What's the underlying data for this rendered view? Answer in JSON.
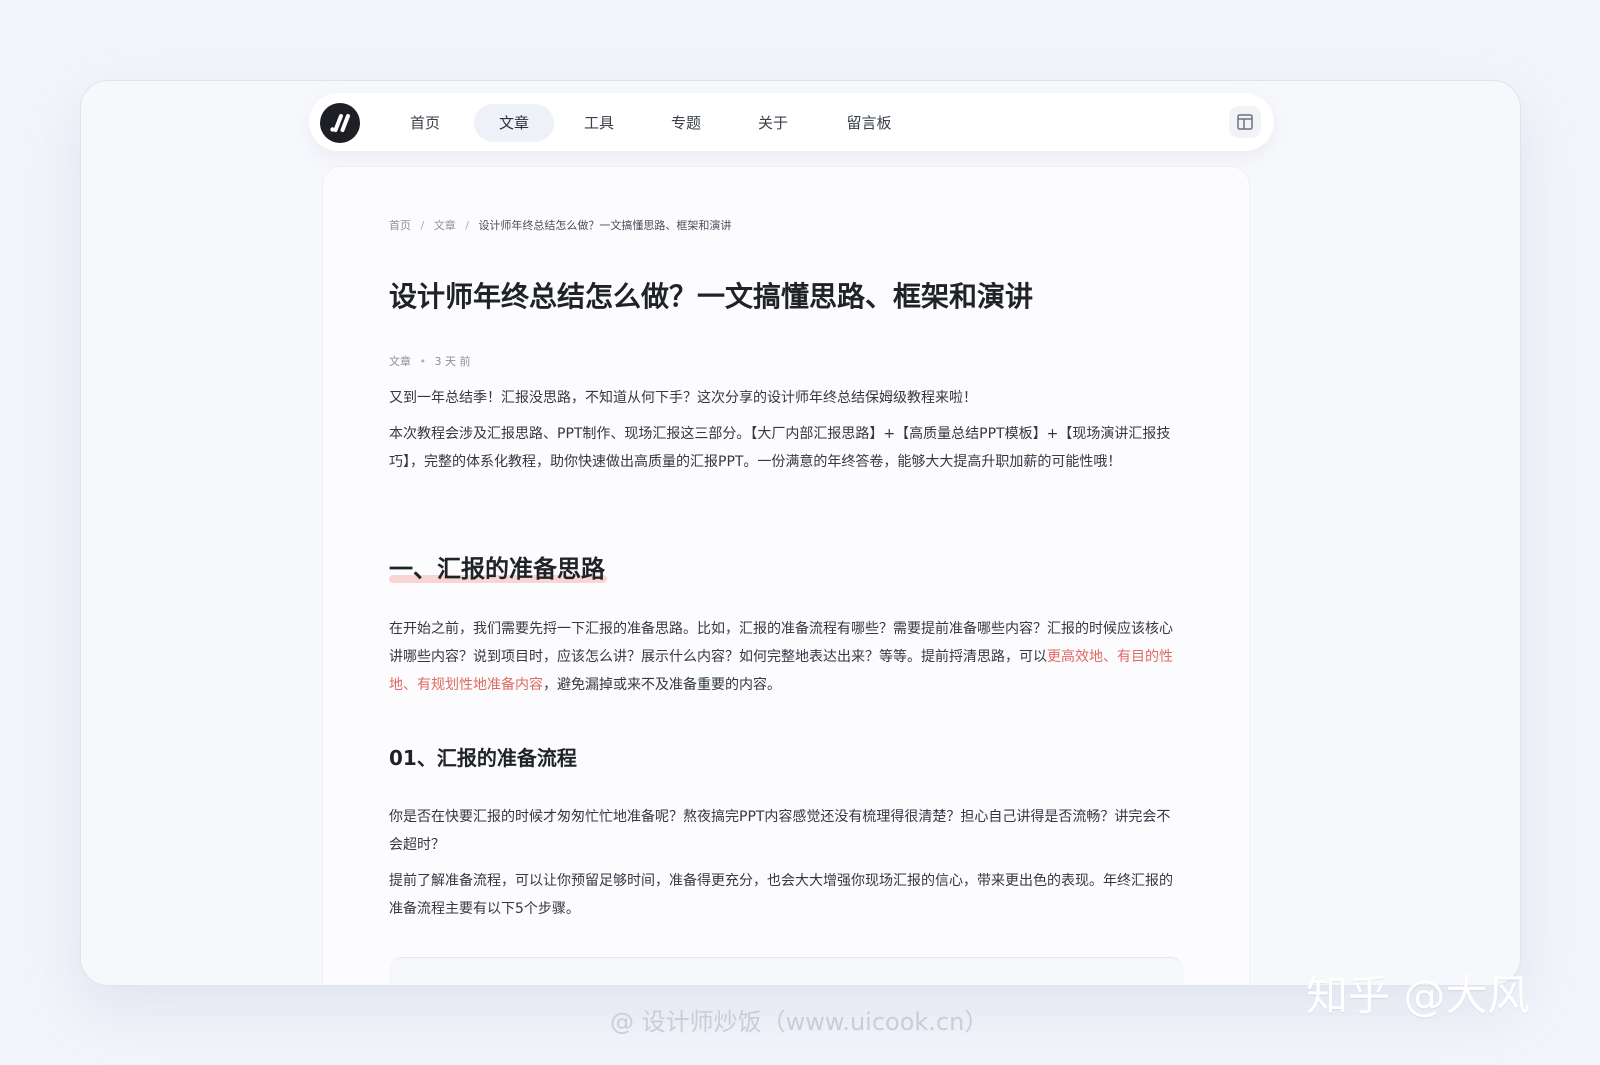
{
  "nav": {
    "items": [
      {
        "label": "首页"
      },
      {
        "label": "文章"
      },
      {
        "label": "工具"
      },
      {
        "label": "专题"
      },
      {
        "label": "关于"
      },
      {
        "label": "留言板"
      }
    ],
    "active_index": 1,
    "logo_icon": "slash-logo-icon",
    "layout_icon": "layout-panel-icon"
  },
  "breadcrumb": {
    "home": "首页",
    "section": "文章",
    "current": "设计师年终总结怎么做？一文搞懂思路、框架和演讲",
    "separator": "/"
  },
  "article": {
    "title": "设计师年终总结怎么做？一文搞懂思路、框架和演讲",
    "meta": {
      "category": "文章",
      "time": "3 天 前",
      "dot": "•"
    },
    "intro_1": "又到一年总结季！汇报没思路，不知道从何下手？这次分享的设计师年终总结保姆级教程来啦！",
    "intro_2": "本次教程会涉及汇报思路、PPT制作、现场汇报这三部分。【大厂内部汇报思路】+【高质量总结PPT模板】+【现场演讲汇报技巧】，完整的体系化教程，助你快速做出高质量的汇报PPT。一份满意的年终答卷，能够大大提高升职加薪的可能性哦！",
    "section_1_title": "一、汇报的准备思路",
    "section_1_para_before": "在开始之前，我们需要先捋一下汇报的准备思路。比如，汇报的准备流程有哪些？需要提前准备哪些内容？汇报的时候应该核心讲哪些内容？说到项目时，应该怎么讲？展示什么内容？如何完整地表达出来？等等。提前捋清思路，可以",
    "section_1_para_highlight": "更高效地、有目的性地、有规划性地准备内容",
    "section_1_para_after": "，避免漏掉或来不及准备重要的内容。",
    "subsection_1_title": "01、汇报的准备流程",
    "subsection_1_para_1": "你是否在快要汇报的时候才匆匆忙忙地准备呢？熬夜搞完PPT内容感觉还没有梳理得很清楚？担心自己讲得是否流畅？讲完会不会超时？",
    "subsection_1_para_2": "提前了解准备流程，可以让你预留足够时间，准备得更充分，也会大大增强你现场汇报的信心，带来更出色的表现。年终汇报的准备流程主要有以下5个步骤。"
  },
  "watermarks": {
    "source": "@ 设计师炒饭（www.uicook.cn）",
    "author": "知乎 @大风"
  },
  "colors": {
    "background": "#f3f5fb",
    "highlight": "#e06a61",
    "heading_underline": "#f8d5d2",
    "active_nav": "#eef1f8"
  }
}
